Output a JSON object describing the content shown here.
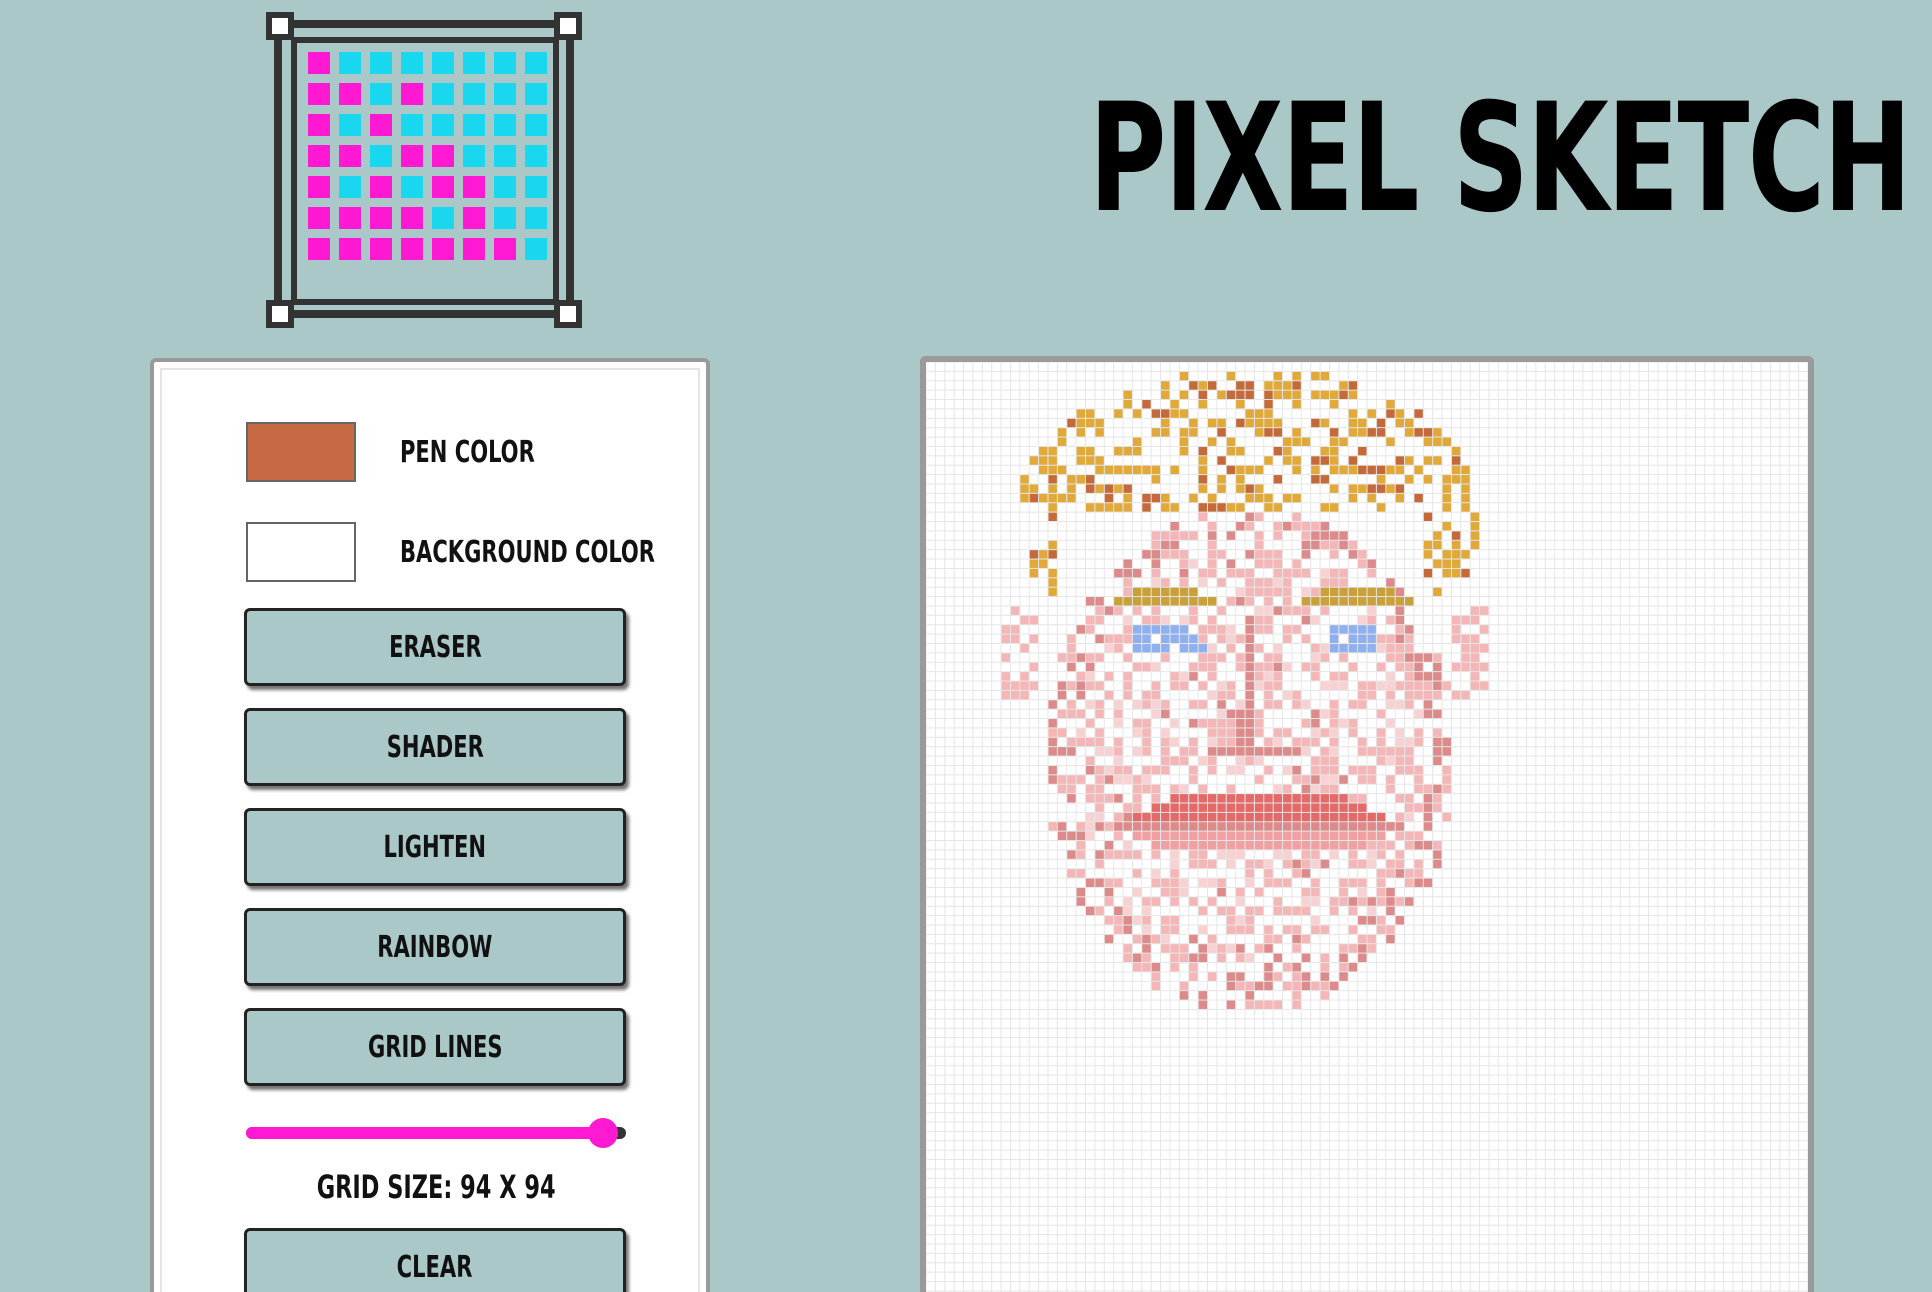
{
  "app": {
    "title": "PIXEL SKETCH"
  },
  "logo": {
    "name": "pixel-grid-logo",
    "colors": {
      "frame": "#333333",
      "magenta": "#ff19d3",
      "cyan": "#1ad7f0"
    }
  },
  "controls": {
    "pen_color": {
      "label": "PEN COLOR",
      "value": "#c76a44"
    },
    "background_color": {
      "label": "BACKGROUND COLOR",
      "value": "#ffffff"
    },
    "buttons": [
      {
        "id": "eraser",
        "label": "ERASER"
      },
      {
        "id": "shader",
        "label": "SHADER"
      },
      {
        "id": "lighten",
        "label": "LIGHTEN"
      },
      {
        "id": "rainbow",
        "label": "RAINBOW"
      },
      {
        "id": "grid-lines",
        "label": "GRID LINES"
      }
    ],
    "grid_size": {
      "min": 1,
      "max": 100,
      "value": 94,
      "label": "GRID SIZE: 94 X 94"
    },
    "clear": {
      "label": "CLEAR"
    }
  },
  "canvas": {
    "grid": 94,
    "background": "#ffffff",
    "grid_line_color": "#e6e6e6",
    "drawing_palette": {
      "hair": "#e0a93a",
      "hair_dark": "#c46a3a",
      "skin": "#f4b6b6",
      "skin_light": "#f8d2d2",
      "skin_dark": "#dc8a8a",
      "brow": "#c9a03a",
      "eye": "#8fb0ee",
      "lip": "#e46a6a",
      "lip_light": "#f0a0a0"
    }
  },
  "colors": {
    "page_background": "#abc8c9",
    "button_background": "#abc8c9",
    "slider_accent": "#ff19d3"
  }
}
